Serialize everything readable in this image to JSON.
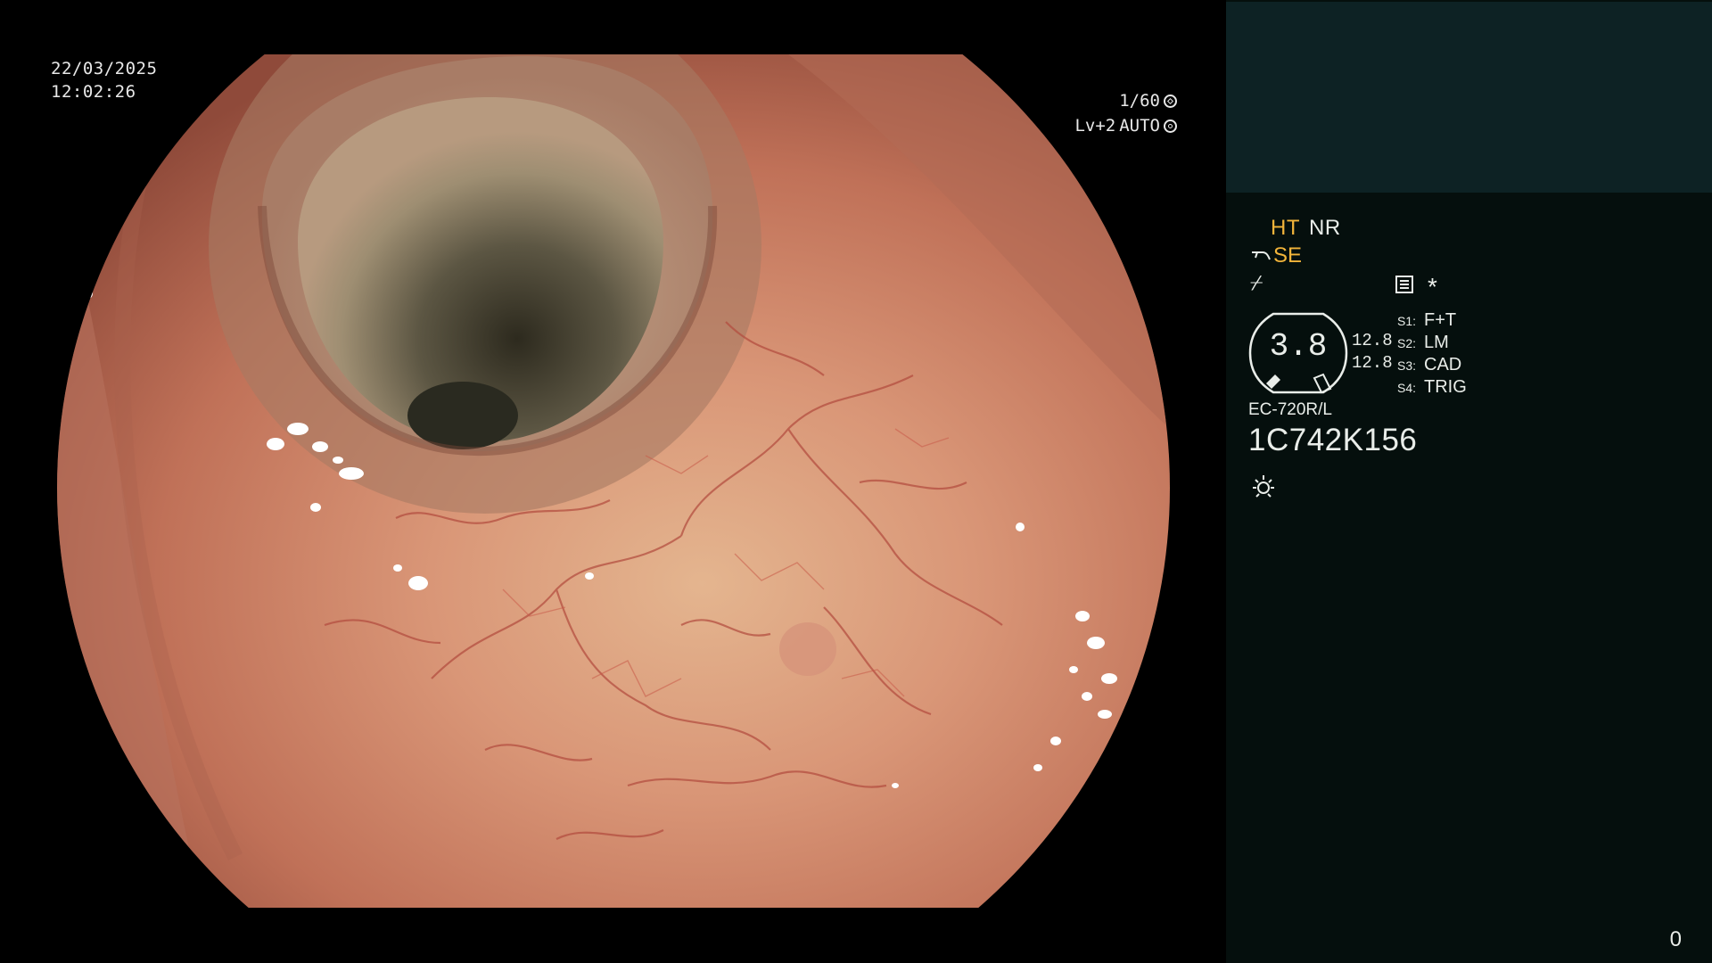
{
  "overlay": {
    "date": "22/03/2025",
    "time": "12:02:26",
    "shutter": "1/60",
    "enhancement": "Lv+2",
    "iris_mode": "AUTO"
  },
  "panel": {
    "ht_label": "HT",
    "nr_label": "NR",
    "se_label": "SE",
    "freeze_symbol": "⌿",
    "asterisk": "*",
    "gauge_value": "3.8",
    "gauge_top": "12.8",
    "gauge_bottom": "12.8",
    "switches": [
      {
        "key": "S1:",
        "value": "F+T"
      },
      {
        "key": "S2:",
        "value": "LM"
      },
      {
        "key": "S3:",
        "value": "CAD"
      },
      {
        "key": "S4:",
        "value": "TRIG"
      }
    ],
    "scope_model": "EC-720R/L",
    "scope_serial": "1C742K156",
    "frame_counter": "0"
  },
  "icons": {
    "shutter": "shutter-icon",
    "iris": "iris-auto-icon",
    "se": "scope-tip-icon",
    "memory": "memory-icon",
    "light": "light-sun-icon"
  },
  "colors": {
    "panel_top": "#0d2224",
    "panel_bottom": "#050f0d",
    "accent_amber": "#f2b43a",
    "mucosa": "#c9785c",
    "lumen": "#3a3526"
  }
}
